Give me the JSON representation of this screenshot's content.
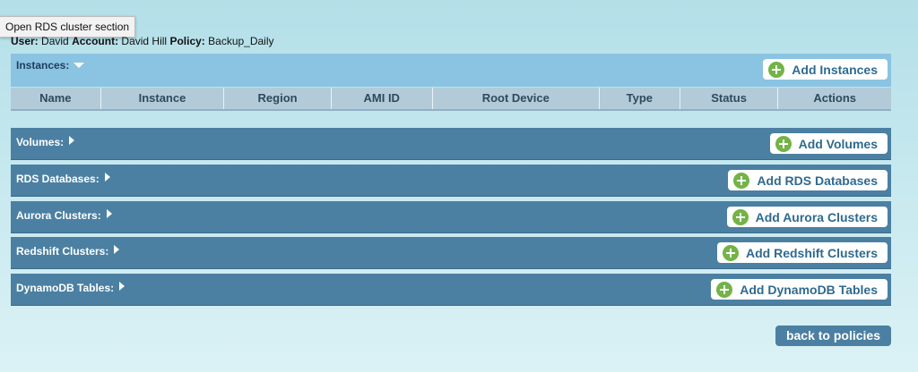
{
  "tooltip": "Open RDS cluster section",
  "userline": {
    "user_label": "User:",
    "user_value": "David",
    "account_label": "Account:",
    "account_value": "David Hill",
    "policy_label": "Policy:",
    "policy_value": "Backup_Daily"
  },
  "instances": {
    "title": "Instances:",
    "add_label": "Add Instances",
    "columns": [
      "Name",
      "Instance",
      "Region",
      "AMI ID",
      "Root Device",
      "Type",
      "Status",
      "Actions"
    ]
  },
  "sections": [
    {
      "title": "Volumes:",
      "add_label": "Add Volumes"
    },
    {
      "title": "RDS Databases:",
      "add_label": "Add RDS Databases"
    },
    {
      "title": "Aurora Clusters:",
      "add_label": "Add Aurora Clusters"
    },
    {
      "title": "Redshift Clusters:",
      "add_label": "Add Redshift Clusters"
    },
    {
      "title": "DynamoDB Tables:",
      "add_label": "Add DynamoDB Tables"
    }
  ],
  "back_label": "back to policies",
  "colors": {
    "section_bg": "#4b80a2",
    "instances_bg": "#8bc3e2",
    "add_icon": "#73b348"
  },
  "icons": {
    "expand": "triangle-right-icon",
    "collapse": "triangle-down-icon",
    "add": "plus-circle-icon"
  }
}
